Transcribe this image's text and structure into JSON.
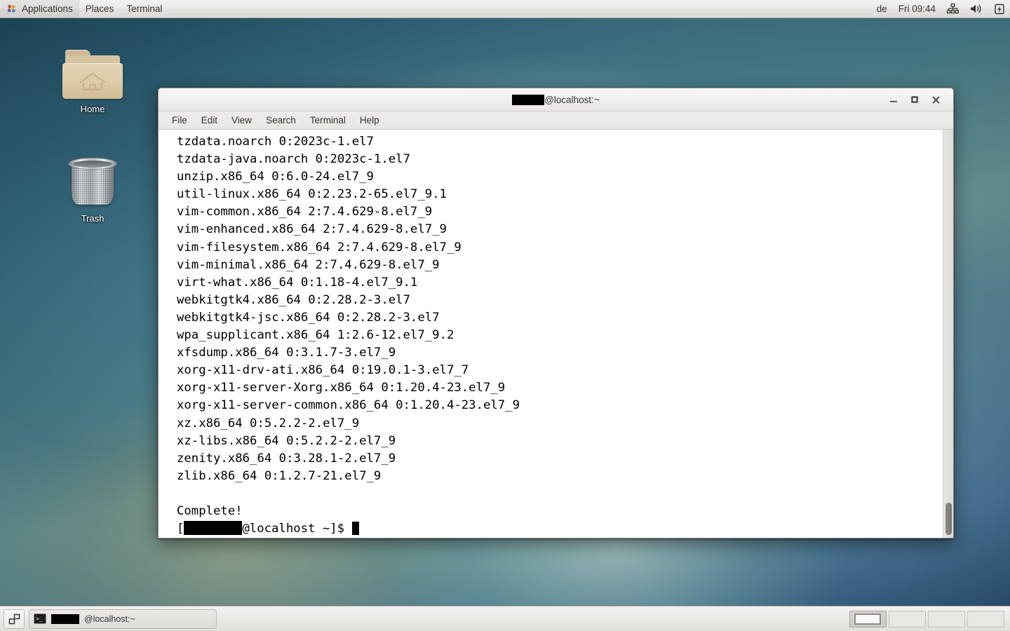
{
  "top_panel": {
    "applications_label": "Applications",
    "places_label": "Places",
    "terminal_label": "Terminal",
    "keyboard_layout": "de",
    "clock": "Fri 09:44",
    "icons": [
      "network-icon",
      "volume-icon",
      "battery-icon"
    ]
  },
  "desktop": {
    "icons": [
      {
        "name": "home",
        "label": "Home"
      },
      {
        "name": "trash",
        "label": "Trash"
      }
    ]
  },
  "window": {
    "title_suffix": "@localhost:~",
    "title_redacted": true,
    "buttons": {
      "minimize": "–",
      "maximize": "□",
      "close": "×"
    },
    "menubar": [
      "File",
      "Edit",
      "View",
      "Search",
      "Terminal",
      "Help"
    ]
  },
  "terminal": {
    "lines": [
      "tzdata.noarch 0:2023c-1.el7",
      "tzdata-java.noarch 0:2023c-1.el7",
      "unzip.x86_64 0:6.0-24.el7_9",
      "util-linux.x86_64 0:2.23.2-65.el7_9.1",
      "vim-common.x86_64 2:7.4.629-8.el7_9",
      "vim-enhanced.x86_64 2:7.4.629-8.el7_9",
      "vim-filesystem.x86_64 2:7.4.629-8.el7_9",
      "vim-minimal.x86_64 2:7.4.629-8.el7_9",
      "virt-what.x86_64 0:1.18-4.el7_9.1",
      "webkitgtk4.x86_64 0:2.28.2-3.el7",
      "webkitgtk4-jsc.x86_64 0:2.28.2-3.el7",
      "wpa_supplicant.x86_64 1:2.6-12.el7_9.2",
      "xfsdump.x86_64 0:3.1.7-3.el7_9",
      "xorg-x11-drv-ati.x86_64 0:19.0.1-3.el7_7",
      "xorg-x11-server-Xorg.x86_64 0:1.20.4-23.el7_9",
      "xorg-x11-server-common.x86_64 0:1.20.4-23.el7_9",
      "xz.x86_64 0:5.2.2-2.el7_9",
      "xz-libs.x86_64 0:5.2.2-2.el7_9",
      "zenity.x86_64 0:3.28.1-2.el7_9",
      "zlib.x86_64 0:1.2.7-21.el7_9",
      "",
      "Complete!"
    ],
    "prompt_prefix": "[",
    "prompt_suffix": "@localhost ~]$ ",
    "prompt_redacted": true,
    "colors": {
      "background": "#ffffff",
      "foreground": "#000000"
    }
  },
  "bottom_panel": {
    "task_label_suffix": "@localhost:~",
    "task_redacted": true,
    "workspace_count": 4,
    "active_workspace": 1
  }
}
